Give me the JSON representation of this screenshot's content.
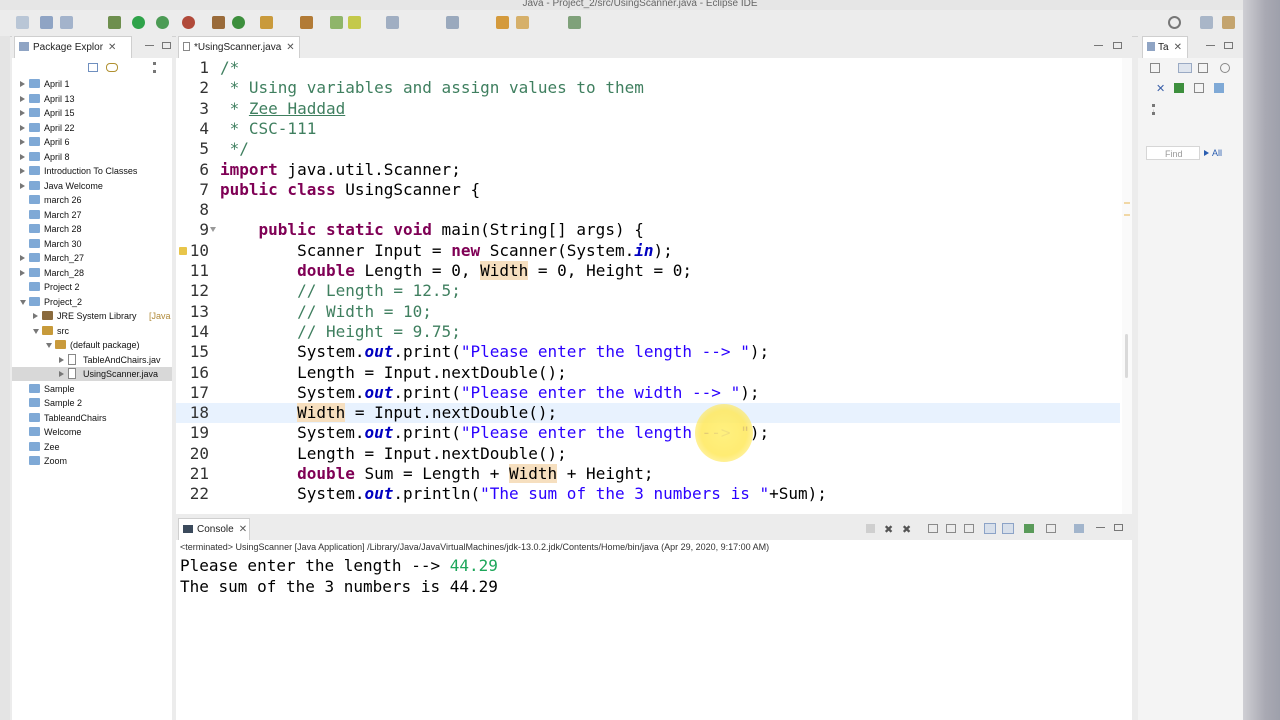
{
  "window": {
    "title": "Java - Project_2/src/UsingScanner.java - Eclipse IDE"
  },
  "colors": {
    "keyword": "#7f0055",
    "comment": "#3f7f5f",
    "string": "#2a00ff",
    "field": "#0000c0",
    "highlight": "#f6dfbf",
    "console_input": "#1da65a"
  },
  "package_explorer": {
    "tab_label": "Package Explor",
    "items": [
      {
        "label": "April 1",
        "level": 0,
        "expand": "collapsed",
        "icon": "project-icon"
      },
      {
        "label": "April 13",
        "level": 0,
        "expand": "collapsed",
        "icon": "project-icon"
      },
      {
        "label": "April 15",
        "level": 0,
        "expand": "collapsed",
        "icon": "project-icon"
      },
      {
        "label": "April 22",
        "level": 0,
        "expand": "collapsed",
        "icon": "project-icon"
      },
      {
        "label": "April 6",
        "level": 0,
        "expand": "collapsed",
        "icon": "project-icon"
      },
      {
        "label": "April 8",
        "level": 0,
        "expand": "collapsed",
        "icon": "project-icon"
      },
      {
        "label": "Introduction To Classes",
        "level": 0,
        "expand": "collapsed",
        "icon": "project-icon"
      },
      {
        "label": "Java Welcome",
        "level": 0,
        "expand": "collapsed",
        "icon": "project-icon"
      },
      {
        "label": "march 26",
        "level": 0,
        "expand": "none",
        "icon": "folder-icon"
      },
      {
        "label": "March 27",
        "level": 0,
        "expand": "none",
        "icon": "folder-icon"
      },
      {
        "label": "March 28",
        "level": 0,
        "expand": "none",
        "icon": "folder-icon"
      },
      {
        "label": "March 30",
        "level": 0,
        "expand": "none",
        "icon": "folder-icon"
      },
      {
        "label": "March_27",
        "level": 0,
        "expand": "collapsed",
        "icon": "project-icon"
      },
      {
        "label": "March_28",
        "level": 0,
        "expand": "collapsed",
        "icon": "project-icon"
      },
      {
        "label": "Project 2",
        "level": 0,
        "expand": "none",
        "icon": "folder-icon"
      },
      {
        "label": "Project_2",
        "level": 0,
        "expand": "expanded",
        "icon": "project-icon"
      },
      {
        "label": "JRE System Library",
        "suffix": "[Java",
        "level": 1,
        "expand": "collapsed",
        "icon": "library-icon"
      },
      {
        "label": "src",
        "level": 1,
        "expand": "expanded",
        "icon": "source-folder-icon"
      },
      {
        "label": "(default package)",
        "level": 2,
        "expand": "expanded",
        "icon": "package-icon"
      },
      {
        "label": "TableAndChairs.jav",
        "level": 3,
        "expand": "collapsed",
        "icon": "java-file-icon"
      },
      {
        "label": "UsingScanner.java",
        "level": 3,
        "expand": "collapsed",
        "icon": "java-file-icon",
        "selected": true
      },
      {
        "label": "Sample",
        "level": 0,
        "expand": "none",
        "icon": "folder-icon"
      },
      {
        "label": "Sample 2",
        "level": 0,
        "expand": "none",
        "icon": "folder-icon"
      },
      {
        "label": "TableandChairs",
        "level": 0,
        "expand": "none",
        "icon": "folder-icon"
      },
      {
        "label": "Welcome",
        "level": 0,
        "expand": "none",
        "icon": "folder-icon"
      },
      {
        "label": "Zee",
        "level": 0,
        "expand": "none",
        "icon": "folder-icon"
      },
      {
        "label": "Zoom",
        "level": 0,
        "expand": "none",
        "icon": "folder-icon"
      }
    ]
  },
  "editor": {
    "tab_label": "*UsingScanner.java",
    "current_line": 18,
    "lines": [
      {
        "n": "1",
        "tokens": [
          [
            "cm",
            "/*"
          ]
        ]
      },
      {
        "n": "2",
        "tokens": [
          [
            "cm",
            " * Using variables and assign values to them"
          ]
        ]
      },
      {
        "n": "3",
        "tokens": [
          [
            "cm",
            " * "
          ],
          [
            "cm-ul",
            "Zee Haddad"
          ]
        ]
      },
      {
        "n": "4",
        "tokens": [
          [
            "cm",
            " * CSC-111"
          ]
        ]
      },
      {
        "n": "5",
        "tokens": [
          [
            "cm",
            " */"
          ]
        ]
      },
      {
        "n": "6",
        "tokens": [
          [
            "kw",
            "import"
          ],
          [
            "p",
            " java.util.Scanner;"
          ]
        ]
      },
      {
        "n": "7",
        "tokens": [
          [
            "kw",
            "public class"
          ],
          [
            "p",
            " UsingScanner {"
          ]
        ]
      },
      {
        "n": "8",
        "tokens": []
      },
      {
        "n": "9",
        "tokens": [
          [
            "p",
            "    "
          ],
          [
            "kw",
            "public static void"
          ],
          [
            "p",
            " main(String[] args) {"
          ]
        ]
      },
      {
        "n": "10",
        "tokens": [
          [
            "p",
            "        Scanner Input = "
          ],
          [
            "kw",
            "new"
          ],
          [
            "p",
            " Scanner(System."
          ],
          [
            "fi",
            "in"
          ],
          [
            "p",
            ");"
          ]
        ]
      },
      {
        "n": "11",
        "tokens": [
          [
            "p",
            "        "
          ],
          [
            "kw",
            "double"
          ],
          [
            "p",
            " Length = 0, "
          ],
          [
            "hl",
            "Width"
          ],
          [
            "p",
            " = 0, Height = 0;"
          ]
        ]
      },
      {
        "n": "12",
        "tokens": [
          [
            "p",
            "        "
          ],
          [
            "cm",
            "// Length = 12.5;"
          ]
        ]
      },
      {
        "n": "13",
        "tokens": [
          [
            "p",
            "        "
          ],
          [
            "cm",
            "// Width = 10;"
          ]
        ]
      },
      {
        "n": "14",
        "tokens": [
          [
            "p",
            "        "
          ],
          [
            "cm",
            "// Height = 9.75;"
          ]
        ]
      },
      {
        "n": "15",
        "tokens": [
          [
            "p",
            "        System."
          ],
          [
            "fi",
            "out"
          ],
          [
            "p",
            ".print("
          ],
          [
            "st",
            "\"Please enter the length --> \""
          ],
          [
            "p",
            ");"
          ]
        ]
      },
      {
        "n": "16",
        "tokens": [
          [
            "p",
            "        Length = Input.nextDouble();"
          ]
        ]
      },
      {
        "n": "17",
        "tokens": [
          [
            "p",
            "        System."
          ],
          [
            "fi",
            "out"
          ],
          [
            "p",
            ".print("
          ],
          [
            "st",
            "\"Please enter the width --> \""
          ],
          [
            "p",
            ");"
          ]
        ]
      },
      {
        "n": "18",
        "tokens": [
          [
            "p",
            "        "
          ],
          [
            "hl",
            "Width"
          ],
          [
            "p",
            " = Input.nextDouble();"
          ]
        ]
      },
      {
        "n": "19",
        "tokens": [
          [
            "p",
            "        System."
          ],
          [
            "fi",
            "out"
          ],
          [
            "p",
            ".print("
          ],
          [
            "st",
            "\"Please enter the length --> \""
          ],
          [
            "p",
            ");"
          ]
        ]
      },
      {
        "n": "20",
        "tokens": [
          [
            "p",
            "        Length = Input.nextDouble();"
          ]
        ]
      },
      {
        "n": "21",
        "tokens": [
          [
            "p",
            "        "
          ],
          [
            "kw",
            "double"
          ],
          [
            "p",
            " Sum = Length + "
          ],
          [
            "hl",
            "Width"
          ],
          [
            "p",
            " + Height;"
          ]
        ]
      },
      {
        "n": "22",
        "tokens": [
          [
            "p",
            "        System."
          ],
          [
            "fi",
            "out"
          ],
          [
            "p",
            ".println("
          ],
          [
            "st",
            "\"The sum of the 3 numbers is \""
          ],
          [
            "p",
            "+Sum);"
          ]
        ]
      }
    ]
  },
  "console": {
    "tab_label": "Console",
    "status": "<terminated> UsingScanner [Java Application] /Library/Java/JavaVirtualMachines/jdk-13.0.2.jdk/Contents/Home/bin/java (Apr 29, 2020, 9:17:00 AM)",
    "lines": [
      {
        "text": "Please enter the length --> ",
        "input": "44.29"
      },
      {
        "text": "The sum of the 3 numbers is 44.29",
        "input": ""
      }
    ]
  },
  "task_list": {
    "tab_label": "Ta",
    "find_placeholder": "Find",
    "all_label": "All"
  }
}
